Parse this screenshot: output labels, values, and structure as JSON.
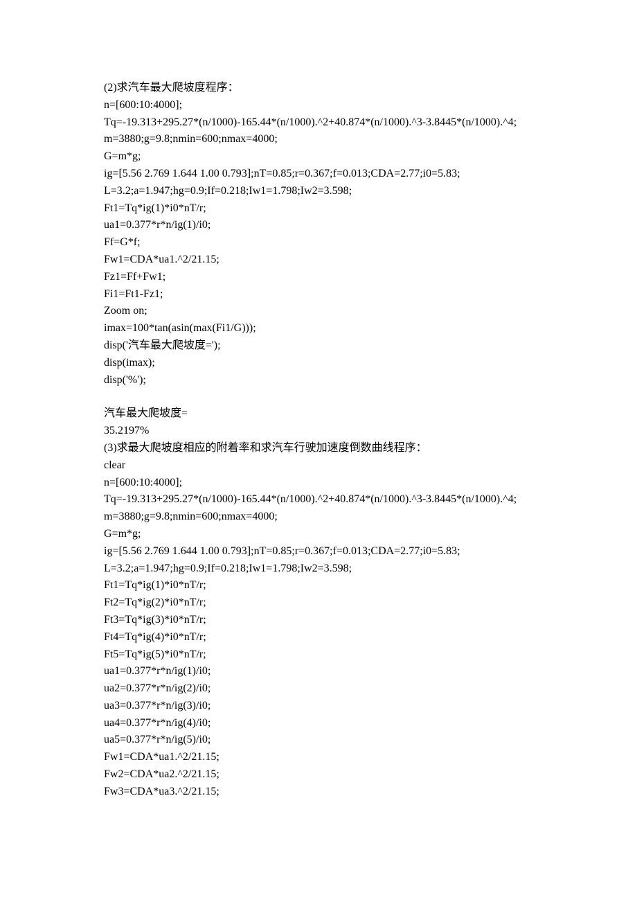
{
  "lines": [
    "(2)求汽车最大爬坡度程序：",
    "n=[600:10:4000];",
    "Tq=-19.313+295.27*(n/1000)-165.44*(n/1000).^2+40.874*(n/1000).^3-3.8445*(n/1000).^4;",
    "m=3880;g=9.8;nmin=600;nmax=4000;",
    "G=m*g;",
    "ig=[5.56 2.769 1.644 1.00 0.793];nT=0.85;r=0.367;f=0.013;CDA=2.77;i0=5.83;",
    "L=3.2;a=1.947;hg=0.9;If=0.218;Iw1=1.798;Iw2=3.598;",
    "Ft1=Tq*ig(1)*i0*nT/r;",
    "ua1=0.377*r*n/ig(1)/i0;",
    "Ff=G*f;",
    "Fw1=CDA*ua1.^2/21.15;",
    "Fz1=Ff+Fw1;",
    "Fi1=Ft1-Fz1;",
    "Zoom on;",
    "imax=100*tan(asin(max(Fi1/G)));",
    "disp('汽车最大爬坡度=');",
    "disp(imax);",
    "disp('%');",
    "",
    "汽车最大爬坡度=",
    "35.2197%",
    "(3)求最大爬坡度相应的附着率和求汽车行驶加速度倒数曲线程序：",
    "clear",
    "n=[600:10:4000];",
    "Tq=-19.313+295.27*(n/1000)-165.44*(n/1000).^2+40.874*(n/1000).^3-3.8445*(n/1000).^4;",
    "m=3880;g=9.8;nmin=600;nmax=4000;",
    "G=m*g;",
    "ig=[5.56 2.769 1.644 1.00 0.793];nT=0.85;r=0.367;f=0.013;CDA=2.77;i0=5.83;",
    "L=3.2;a=1.947;hg=0.9;If=0.218;Iw1=1.798;Iw2=3.598;",
    "Ft1=Tq*ig(1)*i0*nT/r;",
    "Ft2=Tq*ig(2)*i0*nT/r;",
    "Ft3=Tq*ig(3)*i0*nT/r;",
    "Ft4=Tq*ig(4)*i0*nT/r;",
    "Ft5=Tq*ig(5)*i0*nT/r;",
    "ua1=0.377*r*n/ig(1)/i0;",
    "ua2=0.377*r*n/ig(2)/i0;",
    "ua3=0.377*r*n/ig(3)/i0;",
    "ua4=0.377*r*n/ig(4)/i0;",
    "ua5=0.377*r*n/ig(5)/i0;",
    "Fw1=CDA*ua1.^2/21.15;",
    "Fw2=CDA*ua2.^2/21.15;",
    "Fw3=CDA*ua3.^2/21.15;"
  ]
}
